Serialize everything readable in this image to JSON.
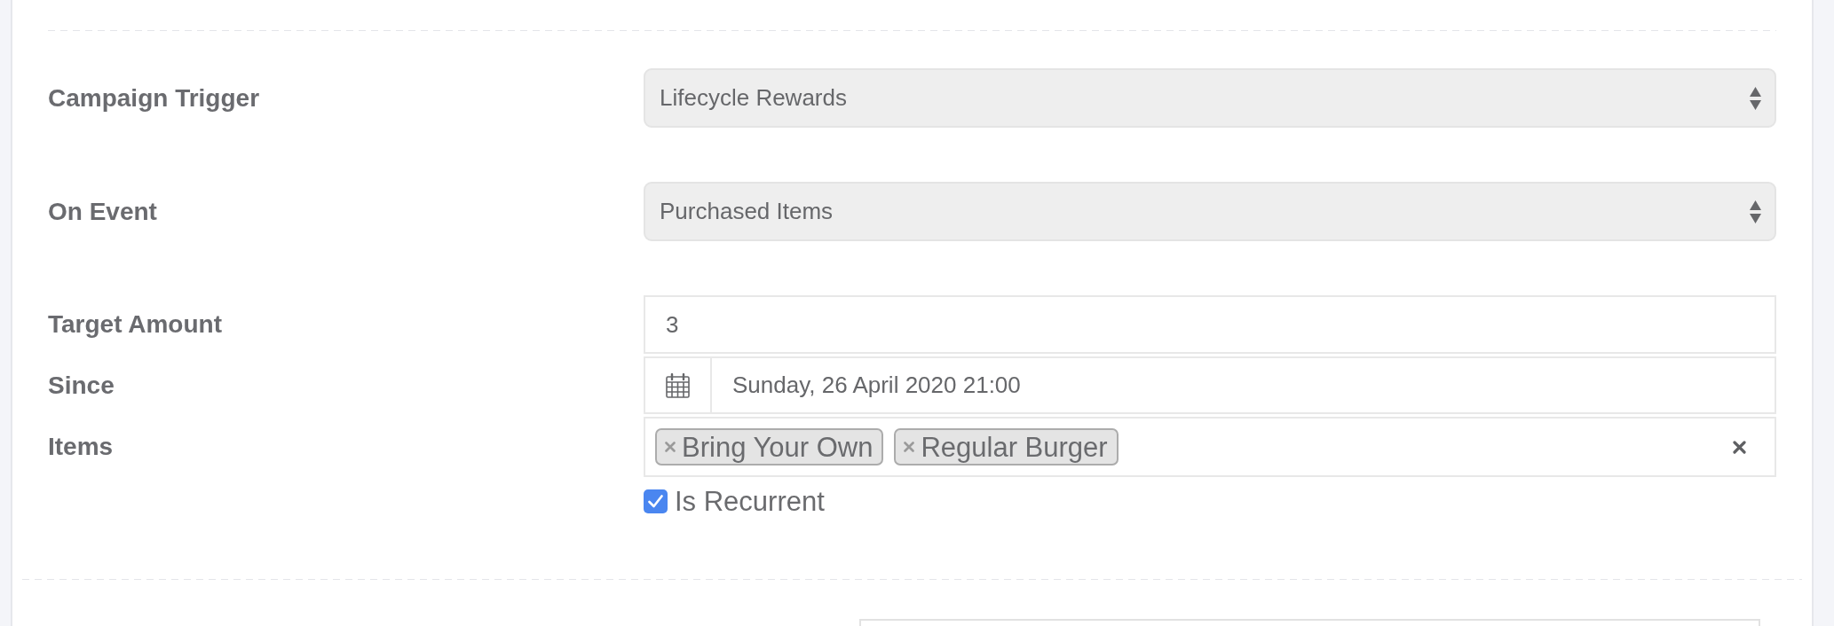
{
  "fields": [
    {
      "kind": "select",
      "label": "Campaign Trigger",
      "value": "Lifecycle Rewards"
    },
    {
      "kind": "select",
      "label": "On Event",
      "value": "Purchased Items"
    },
    {
      "kind": "text",
      "label": "Target Amount",
      "value": "3"
    },
    {
      "kind": "date",
      "label": "Since",
      "value": "Sunday, 26 April 2020 21:00"
    },
    {
      "kind": "tags",
      "label": "Items",
      "tags": [
        "Bring Your Own",
        "Regular Burger"
      ]
    }
  ],
  "recurrent": {
    "label": "Is Recurrent",
    "checked": true
  }
}
